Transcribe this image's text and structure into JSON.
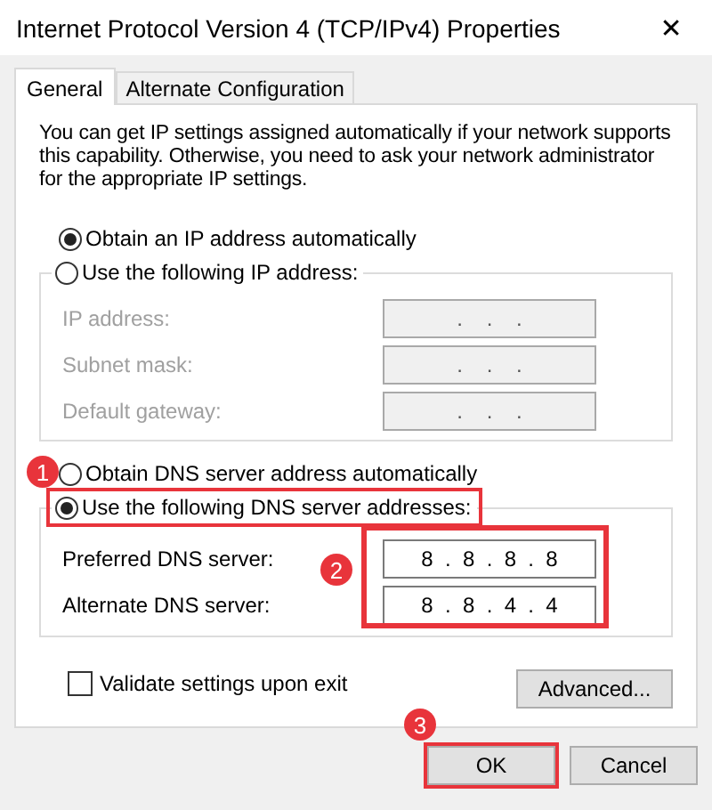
{
  "window": {
    "title": "Internet Protocol Version 4 (TCP/IPv4) Properties",
    "close": "✕"
  },
  "tabs": [
    {
      "label": "General",
      "selected": true
    },
    {
      "label": "Alternate Configuration",
      "selected": false
    }
  ],
  "description": "You can get IP settings assigned automatically if your network supports this capability. Otherwise, you need to ask your network administrator for the appropriate IP settings.",
  "ip_options": [
    {
      "label": "Obtain an IP address automatically",
      "selected": true
    },
    {
      "label": "Use the following IP address:",
      "selected": false
    }
  ],
  "ip_fields": [
    {
      "label": "IP address:",
      "value": ".    .    .",
      "disabled": true
    },
    {
      "label": "Subnet mask:",
      "value": ".    .    .",
      "disabled": true
    },
    {
      "label": "Default gateway:",
      "value": ".    .    .",
      "disabled": true
    }
  ],
  "dns_options": [
    {
      "label": "Obtain DNS server address automatically",
      "selected": false,
      "highlighted": false,
      "badge": "1"
    },
    {
      "label": "Use the following DNS server addresses:",
      "selected": true,
      "highlighted": true
    }
  ],
  "dns_fields_highlighted": true,
  "dns_badge": "2",
  "dns_fields": [
    {
      "label": "Preferred DNS server:",
      "value": "8  .  8  .  8  .  8",
      "disabled": false
    },
    {
      "label": "Alternate DNS server:",
      "value": "8  .  8  .  4  .  4",
      "disabled": false
    }
  ],
  "validate": {
    "label": "Validate settings upon exit",
    "checked": false
  },
  "advanced_button": "Advanced...",
  "buttons": [
    {
      "label": "OK",
      "highlighted": true,
      "badge": "3"
    },
    {
      "label": "Cancel",
      "highlighted": false
    }
  ]
}
